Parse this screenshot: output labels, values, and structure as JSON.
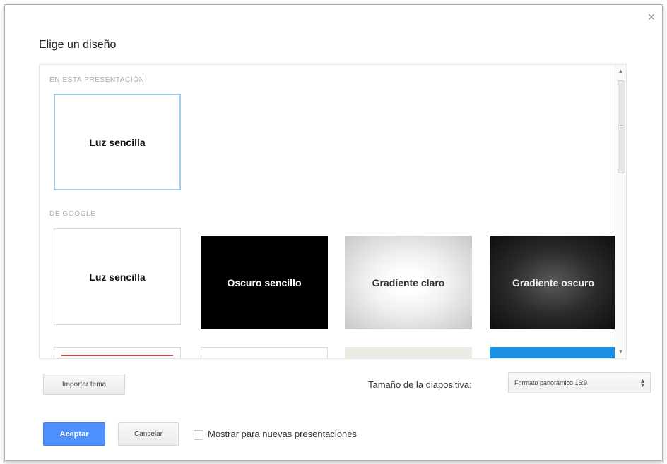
{
  "dialog": {
    "title": "Elige un diseño",
    "close_icon": "close-icon"
  },
  "sections": {
    "in_presentation": {
      "label": "EN ESTA PRESENTACIÓN",
      "themes": [
        {
          "name": "Luz sencilla",
          "style": "light",
          "selected": true
        }
      ]
    },
    "google": {
      "label": "DE GOOGLE",
      "themes": [
        {
          "name": "Luz sencilla",
          "style": "light"
        },
        {
          "name": "Oscuro sencillo",
          "style": "dark"
        },
        {
          "name": "Gradiente claro",
          "style": "gradient-light"
        },
        {
          "name": "Gradiente oscuro",
          "style": "gradient-dark"
        }
      ]
    }
  },
  "footer": {
    "import_label": "Importar tema",
    "size_label": "Tamaño de la diapositiva:",
    "size_value": "Formato panorámico 16:9",
    "accept_label": "Aceptar",
    "cancel_label": "Cancelar",
    "show_new_label": "Mostrar para nuevas presentaciones",
    "show_new_checked": false
  },
  "colors": {
    "accent": "#4d90fe",
    "selected_border": "#9fcbe8"
  }
}
